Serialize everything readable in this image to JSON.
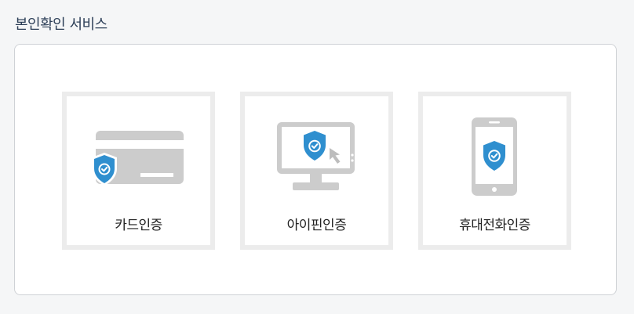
{
  "page": {
    "title": "본인확인 서비스"
  },
  "colors": {
    "shield": "#2f8fcf",
    "device_gray": "#cccccc",
    "card_border": "#ececec",
    "title_text": "#2c3e57"
  },
  "options": [
    {
      "label": "카드인증",
      "icon": "credit-card-shield-icon"
    },
    {
      "label": "아이핀인증",
      "icon": "monitor-shield-cursor-icon"
    },
    {
      "label": "휴대전화인증",
      "icon": "smartphone-shield-icon"
    }
  ]
}
